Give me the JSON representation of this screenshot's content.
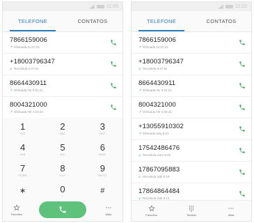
{
  "left": {
    "status_time": "11:56",
    "tabs": [
      {
        "label": "TELEFONE",
        "active": true
      },
      {
        "label": "CONTATOS",
        "active": false
      }
    ],
    "calls": [
      {
        "number": "7866159006",
        "meta": "Efetuada 11:07:23",
        "type": "outgoing"
      },
      {
        "number": "+18003796347",
        "meta": "Recebida 9:47:51",
        "type": "incoming"
      },
      {
        "number": "8664430911",
        "meta": "Efetuada Ter 5:01:21",
        "type": "outgoing"
      },
      {
        "number": "8004321000",
        "meta": "Efetuada Ter 4:20:21",
        "type": "outgoing"
      }
    ],
    "keys": [
      {
        "digit": "1",
        "letters": "OO"
      },
      {
        "digit": "2",
        "letters": "ABC"
      },
      {
        "digit": "3",
        "letters": "DEF"
      },
      {
        "digit": "4",
        "letters": "GHI"
      },
      {
        "digit": "5",
        "letters": "JKL"
      },
      {
        "digit": "6",
        "letters": "MNO"
      },
      {
        "digit": "7",
        "letters": "PQRS"
      },
      {
        "digit": "8",
        "letters": "TUV"
      },
      {
        "digit": "9",
        "letters": "WXYZ"
      },
      {
        "digit": "∗",
        "letters": ""
      },
      {
        "digit": "0",
        "letters": "+"
      },
      {
        "digit": "#",
        "letters": ""
      }
    ],
    "bottom": {
      "favorites_label": "Favoritos",
      "more_label": "Mais"
    }
  },
  "right": {
    "status_time": "11:22",
    "tabs": [
      {
        "label": "TELEFONE",
        "active": true
      },
      {
        "label": "CONTATOS",
        "active": false
      }
    ],
    "calls": [
      {
        "number": "7866159006",
        "meta": "Efetuada 11:07:23",
        "type": "outgoing"
      },
      {
        "number": "+18003796347",
        "meta": "Recebida 9:47:51",
        "type": "incoming"
      },
      {
        "number": "8664430911",
        "meta": "Efetuada Ter 5:01:21",
        "type": "outgoing"
      },
      {
        "number": "8004321000",
        "meta": "Efetuada Ter 4:20:21",
        "type": "outgoing"
      },
      {
        "number": "+13055910302",
        "meta": "Efetuada Seg 8:21",
        "type": "outgoing"
      },
      {
        "number": "17542486476",
        "meta": "Recebida Dom 8:29",
        "type": "incoming"
      },
      {
        "number": "17867095883",
        "meta": "Recebida Sab 8:19",
        "type": "incoming"
      },
      {
        "number": "17864864484",
        "meta": "Recebida Sab 8:14",
        "type": "incoming"
      }
    ],
    "bottom": {
      "favorites_label": "Favoritos",
      "dialpad_label": "Teclado",
      "more_label": "Mais"
    }
  },
  "colors": {
    "accent": "#2b80c0",
    "call_green": "#5ec27c"
  }
}
